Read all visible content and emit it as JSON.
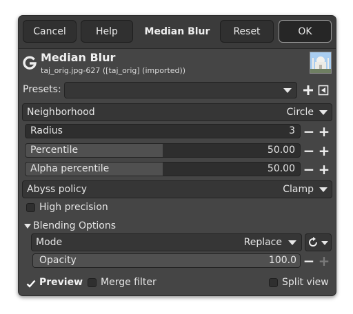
{
  "header": {
    "cancel_label": "Cancel",
    "help_label": "Help",
    "title": "Median Blur",
    "reset_label": "Reset",
    "ok_label": "OK"
  },
  "filter": {
    "title": "Median Blur",
    "subtitle": "taj_orig.jpg-627 ([taj_orig] (imported))",
    "logo_icon": "gimp-logo-icon",
    "thumbnail": "image-thumbnail-taj-mahal"
  },
  "presets": {
    "label": "Presets:",
    "value": "",
    "add_icon": "plus-icon",
    "menu_icon": "preset-menu-icon"
  },
  "neighborhood": {
    "label": "Neighborhood",
    "value": "Circle"
  },
  "radius": {
    "label": "Radius",
    "value": "3",
    "fill_fraction": 0.0
  },
  "percentile": {
    "label": "Percentile",
    "value": "50.00",
    "fill_fraction": 0.5
  },
  "alpha_percentile": {
    "label": "Alpha percentile",
    "value": "50.00",
    "fill_fraction": 0.5
  },
  "abyss": {
    "label": "Abyss policy",
    "value": "Clamp"
  },
  "high_precision": {
    "label": "High precision",
    "checked": false
  },
  "blending": {
    "section_label": "Blending Options",
    "expanded": true,
    "mode_label": "Mode",
    "mode_value": "Replace",
    "composite_icon": "composite-mode-icon",
    "opacity_label": "Opacity",
    "opacity_value": "100.0",
    "opacity_fraction": 1.0
  },
  "footer": {
    "preview_label": "Preview",
    "preview_checked": true,
    "merge_label": "Merge filter",
    "merge_checked": false,
    "split_label": "Split view",
    "split_checked": false
  },
  "colors": {
    "dialog_bg": "#454545",
    "header_bg": "#3b3b3b",
    "field_bg": "#2e2e2e",
    "slider_fill": "#505050",
    "text": "#e6e6e6"
  }
}
